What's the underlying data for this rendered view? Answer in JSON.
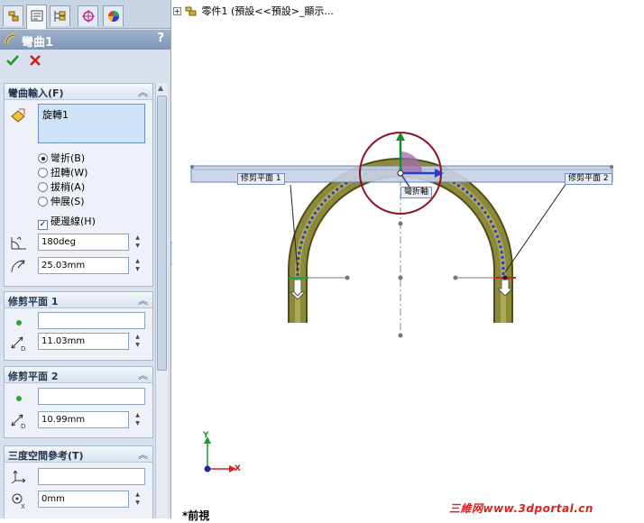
{
  "panel": {
    "tabs": [
      "feature-manager-icon",
      "property-manager-icon",
      "configuration-manager-icon",
      "dimxpert-icon",
      "display-manager-icon"
    ],
    "title": "彎曲1",
    "help_label": "?",
    "ok_icon": "checkmark-icon",
    "cancel_icon": "x-icon",
    "bend_input": {
      "header": "彎曲輸入(F)",
      "selection_value": "旋轉1",
      "options": [
        {
          "label": "彎折(B)",
          "selected": true
        },
        {
          "label": "扭轉(W)",
          "selected": false
        },
        {
          "label": "拔梢(A)",
          "selected": false
        },
        {
          "label": "伸展(S)",
          "selected": false
        }
      ],
      "hard_edges_label": "硬邊線(H)",
      "hard_edges_checked": true,
      "angle_value": "180deg",
      "radius_value": "25.03mm"
    },
    "trim_plane_1": {
      "header": "修剪平面 1",
      "entity_value": "",
      "distance_value": "11.03mm"
    },
    "trim_plane_2": {
      "header": "修剪平面 2",
      "entity_value": "",
      "distance_value": "10.99mm"
    },
    "triad": {
      "header": "三度空間參考(T)",
      "entity_value": "",
      "x_value": "0mm"
    }
  },
  "viewport": {
    "tree_label": "零件1 (預設<<預設>_顯示...",
    "trim_plane_1_label": "修剪平面 1",
    "trim_plane_2_label": "修剪平面 2",
    "bend_axis_label": "彎折軸",
    "view_name": "*前視",
    "axis_y": "Y",
    "axis_x": "X",
    "watermark": "三維网www.3dportal.cn"
  }
}
